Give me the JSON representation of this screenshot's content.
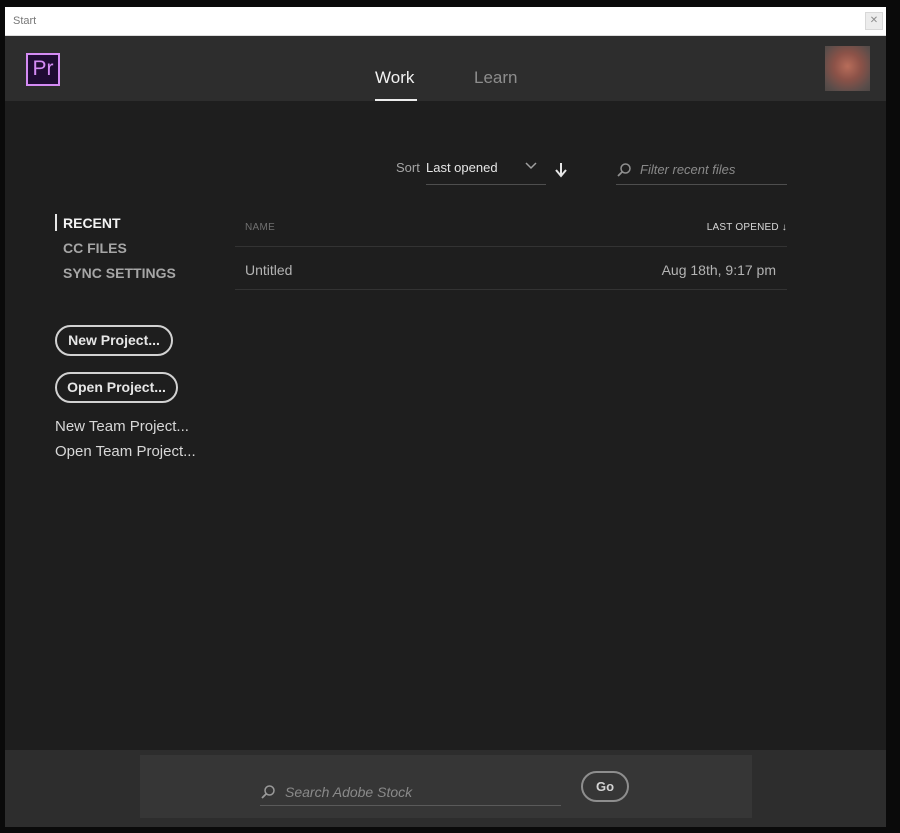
{
  "window": {
    "title": "Start",
    "close_icon": "close-icon"
  },
  "header": {
    "app_logo": "Pr",
    "tabs": [
      {
        "label": "Work",
        "active": true
      },
      {
        "label": "Learn",
        "active": false
      }
    ],
    "avatar_icon": "user-avatar"
  },
  "sort": {
    "label": "Sort",
    "value": "Last opened",
    "direction_icon": "arrow-down-icon"
  },
  "filter": {
    "placeholder": "Filter recent files"
  },
  "nav": {
    "items": [
      {
        "label": "RECENT",
        "active": true
      },
      {
        "label": "CC FILES",
        "active": false
      },
      {
        "label": "SYNC SETTINGS",
        "active": false
      }
    ]
  },
  "actions": {
    "new_project": "New Project...",
    "open_project": "Open Project...",
    "new_team_project": "New Team Project...",
    "open_team_project": "Open Team Project..."
  },
  "list": {
    "columns": {
      "name": "NAME",
      "last_opened": "LAST OPENED ↓"
    },
    "rows": [
      {
        "name": "Untitled",
        "last_opened": "Aug 18th, 9:17 pm"
      }
    ]
  },
  "footer": {
    "stock_search_placeholder": "Search Adobe Stock",
    "go_label": "Go"
  },
  "colors": {
    "accent": "#d48bf4",
    "background": "#1e1e1e",
    "header": "#2d2d2d"
  }
}
